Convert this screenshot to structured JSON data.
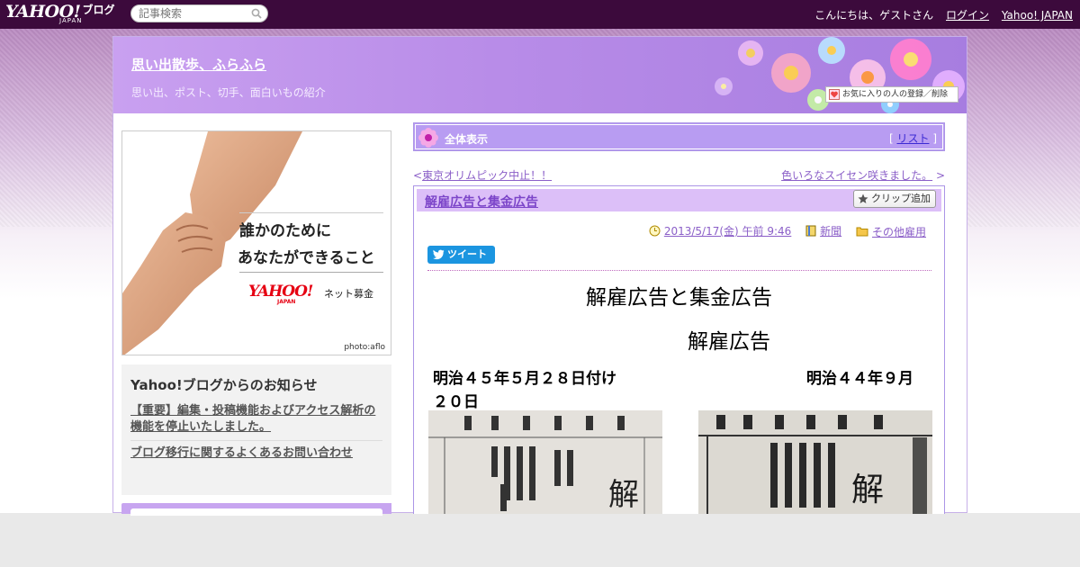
{
  "topbar": {
    "logo_text": "YAHOO!",
    "logo_blog": "ブログ",
    "logo_japan": "JAPAN",
    "search_placeholder": "記事検索",
    "greeting": "こんにちは、ゲストさん",
    "login": "ログイン",
    "yahoo_japan": "Yahoo! JAPAN"
  },
  "blog": {
    "title": "思い出散歩、ふらふら",
    "description": "思い出、ポスト、切手、面白いもの紹介",
    "favorite_button": "お気に入りの人の登録／削除"
  },
  "ad": {
    "line1": "誰かのために",
    "line2": "あなたができること",
    "brand": "YAHOO!",
    "brand_japan": "JAPAN",
    "brand_sub": "ネット募金",
    "credit": "photo:aflo"
  },
  "notice": {
    "heading": "Yahoo!ブログからのお知らせ",
    "items": [
      "【重要】編集・投稿機能およびアクセス解析の機能を停止いたしました。",
      "ブログ移行に関するよくあるお問い合わせ"
    ]
  },
  "view_bar": {
    "label": "全体表示",
    "list_open": "[",
    "list_link": "リスト",
    "list_close": "]"
  },
  "nav": {
    "prev_arrow": "<",
    "prev": "東京オリムピック中止！！",
    "next": "色いろなスイセン咲きました。",
    "next_arrow": ">"
  },
  "post": {
    "title": "解雇広告と集金広告",
    "clip_button": "クリップ追加",
    "date": "2013/5/17(金) 午前 9:46",
    "category1": "新聞",
    "category2": "その他雇用",
    "tweet": "ツイート",
    "heading": "解雇広告と集金広告",
    "subheading": "解雇広告",
    "date_left": "明治４５年５月２８日付け",
    "date_right": "明治４４年９月",
    "date_left_cont": "２０日"
  },
  "colors": {
    "topbar": "#3c0a3c",
    "header": "#b88ce8",
    "accent": "#8b5fc8",
    "tweet": "#1b95e0"
  }
}
